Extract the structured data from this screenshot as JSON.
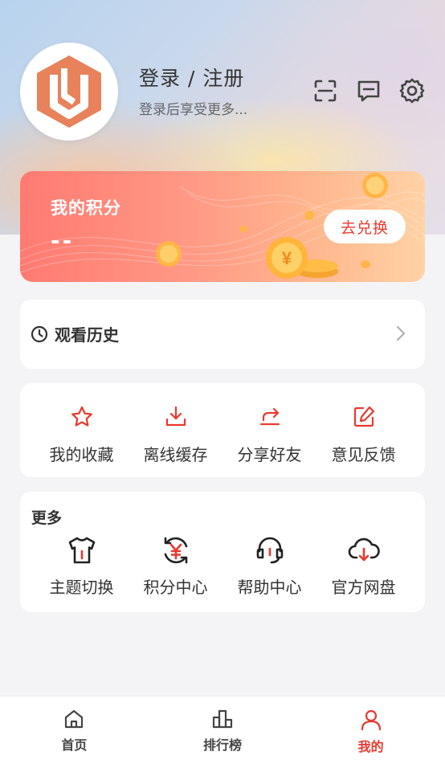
{
  "header": {
    "login_title": "登录 / 注册",
    "login_subtitle": "登录后享受更多..."
  },
  "top_icons": [
    "scan-icon",
    "message-icon",
    "settings-icon"
  ],
  "points_card": {
    "title": "我的积分",
    "value": "--",
    "redeem_label": "去兑换"
  },
  "history": {
    "label": "观看历史"
  },
  "quick_actions": [
    {
      "label": "我的收藏",
      "icon": "star-icon"
    },
    {
      "label": "离线缓存",
      "icon": "download-icon"
    },
    {
      "label": "分享好友",
      "icon": "share-icon"
    },
    {
      "label": "意见反馈",
      "icon": "edit-icon"
    }
  ],
  "more": {
    "title": "更多",
    "items": [
      {
        "label": "主题切换",
        "icon": "tshirt-icon"
      },
      {
        "label": "积分中心",
        "icon": "yen-refresh-icon"
      },
      {
        "label": "帮助中心",
        "icon": "headset-icon"
      },
      {
        "label": "官方网盘",
        "icon": "cloud-download-icon"
      }
    ]
  },
  "tabbar": [
    {
      "label": "首页",
      "icon": "home-icon",
      "active": false
    },
    {
      "label": "排行榜",
      "icon": "rank-icon",
      "active": false
    },
    {
      "label": "我的",
      "icon": "user-icon",
      "active": true
    }
  ],
  "colors": {
    "accent": "#e8392f",
    "logo": "#e8825a",
    "page_bg": "#f4f4f6"
  }
}
